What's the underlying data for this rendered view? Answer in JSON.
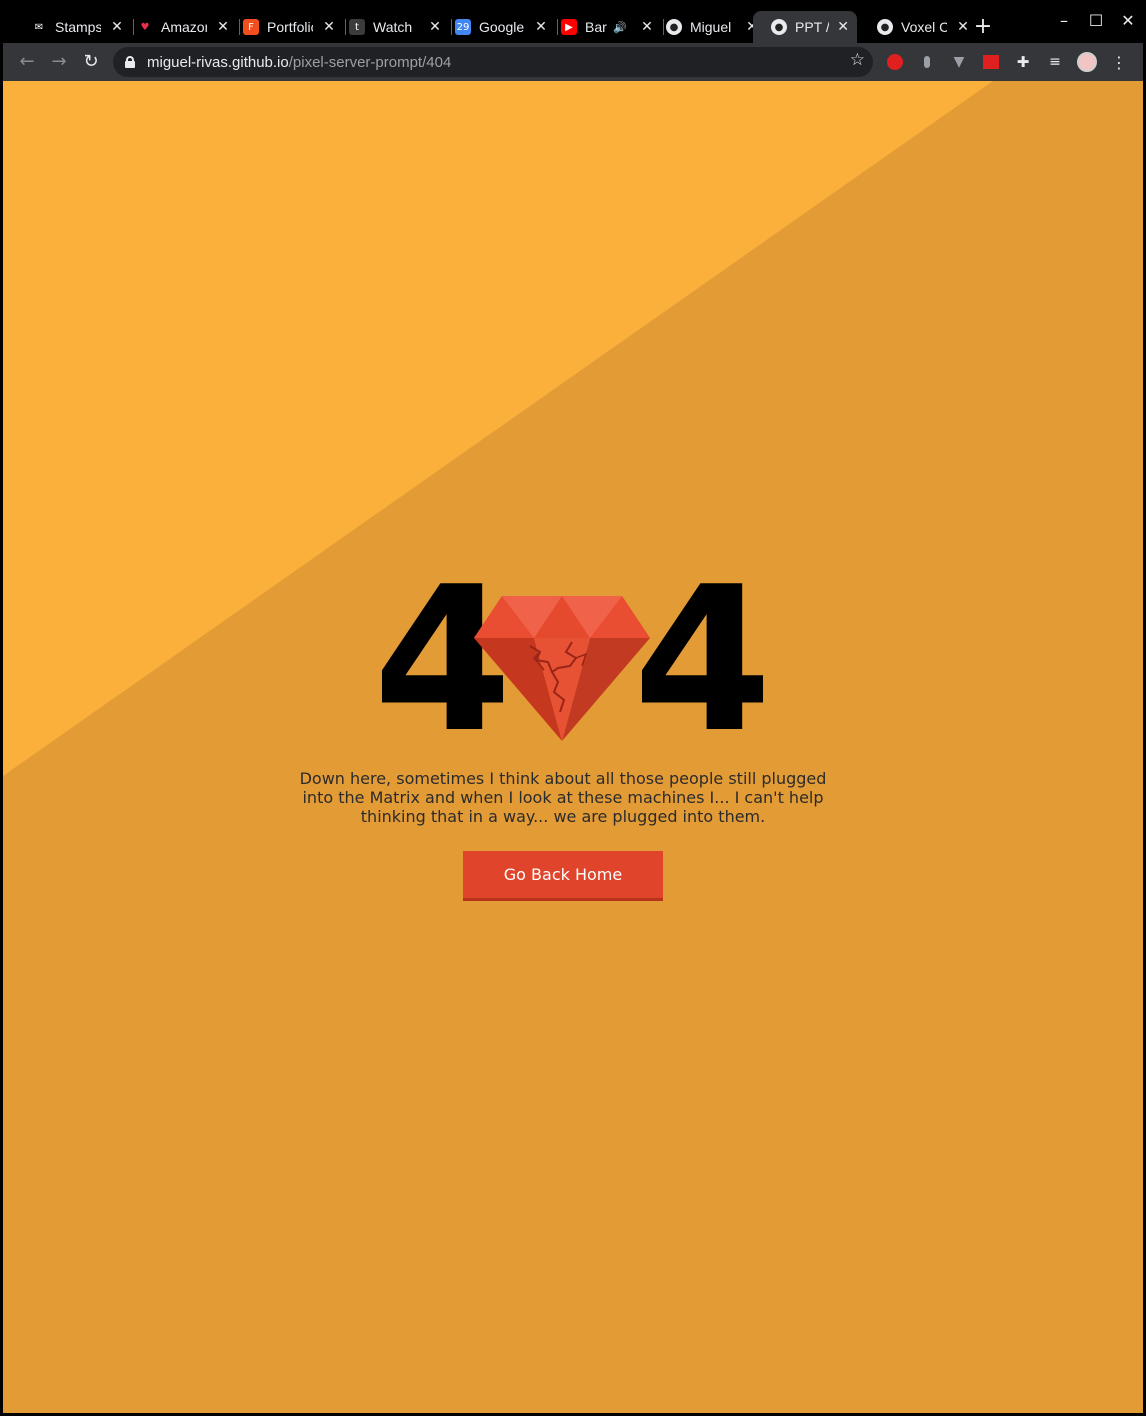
{
  "browser": {
    "tabs": [
      {
        "title": "Stamps",
        "favicon": "stamp-favicon",
        "color": "#ffffff",
        "active": false
      },
      {
        "title": "Amazon",
        "favicon": "amazon-favicon",
        "color": "#e8304d",
        "active": false
      },
      {
        "title": "Portfolio",
        "favicon": "figma-favicon",
        "color": "#f24e1e",
        "active": false
      },
      {
        "title": "Watch",
        "favicon": "watch-favicon",
        "color": "#3c3c3c",
        "active": false
      },
      {
        "title": "Google",
        "favicon": "calendar-favicon",
        "color": "#4285f4",
        "active": false
      },
      {
        "title": "Bar",
        "favicon": "youtube-favicon",
        "color": "#ff0000",
        "active": false,
        "audio": true
      },
      {
        "title": "Miguel",
        "favicon": "github-favicon",
        "color": "#e8eaed",
        "active": false
      },
      {
        "title": "PPT //",
        "favicon": "github-favicon",
        "color": "#e8eaed",
        "active": true
      },
      {
        "title": "Voxel C",
        "favicon": "github-favicon",
        "color": "#e8eaed",
        "active": false
      }
    ],
    "new_tab_label": "+",
    "window_controls": {
      "minimize": "–",
      "maximize": "☐",
      "close": "✕"
    },
    "nav": {
      "back": "←",
      "forward": "→",
      "reload": "↻"
    },
    "url": {
      "host": "miguel-rivas.github.io",
      "path": "/pixel-server-prompt/404"
    },
    "star_icon": "☆",
    "menu_icon": "⋮"
  },
  "page": {
    "error_left": "4",
    "error_right": "4",
    "message": "Down here, sometimes I think about all those people still plugged into the Matrix and when I look at these machines I... I can't help thinking that in a way... we are plugged into them.",
    "button_label": "Go Back Home",
    "colors": {
      "background": "#e39b36",
      "background_light": "#fbb03b",
      "gem": "#e64a2e",
      "button": "#e0442a"
    }
  }
}
